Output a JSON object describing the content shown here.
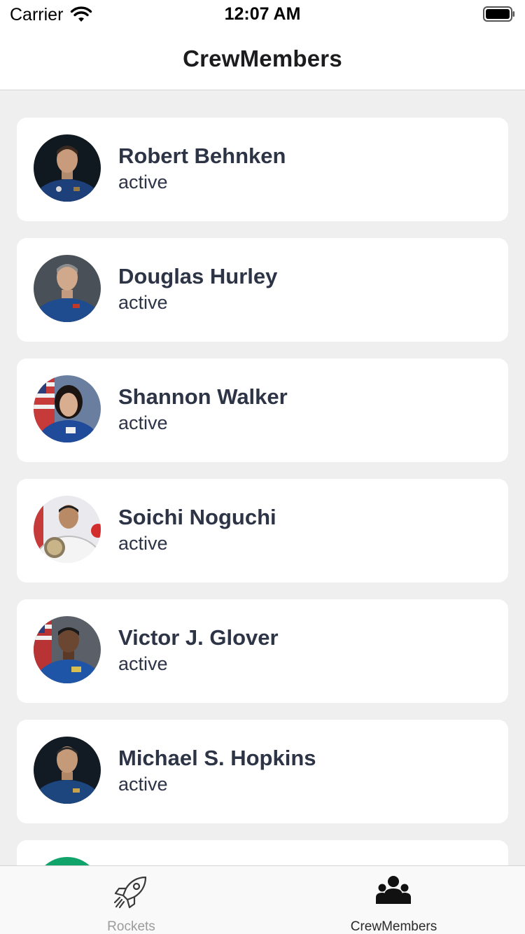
{
  "status_bar": {
    "carrier": "Carrier",
    "time": "12:07 AM"
  },
  "nav": {
    "title": "CrewMembers"
  },
  "crew": [
    {
      "name": "Robert Behnken",
      "status": "active"
    },
    {
      "name": "Douglas Hurley",
      "status": "active"
    },
    {
      "name": "Shannon Walker",
      "status": "active"
    },
    {
      "name": "Soichi Noguchi",
      "status": "active"
    },
    {
      "name": "Victor J. Glover",
      "status": "active"
    },
    {
      "name": "Michael S. Hopkins",
      "status": "active"
    }
  ],
  "tabs": [
    {
      "label": "Rockets",
      "icon": "rocket-icon",
      "selected": false
    },
    {
      "label": "CrewMembers",
      "icon": "users-icon",
      "selected": true
    }
  ],
  "colors": {
    "background": "#efefef",
    "card": "#ffffff",
    "text": "#2d3446",
    "tab_inactive": "#9b9b9b",
    "tab_active": "#2a2a2a",
    "partial_avatar": "#10a36a"
  }
}
